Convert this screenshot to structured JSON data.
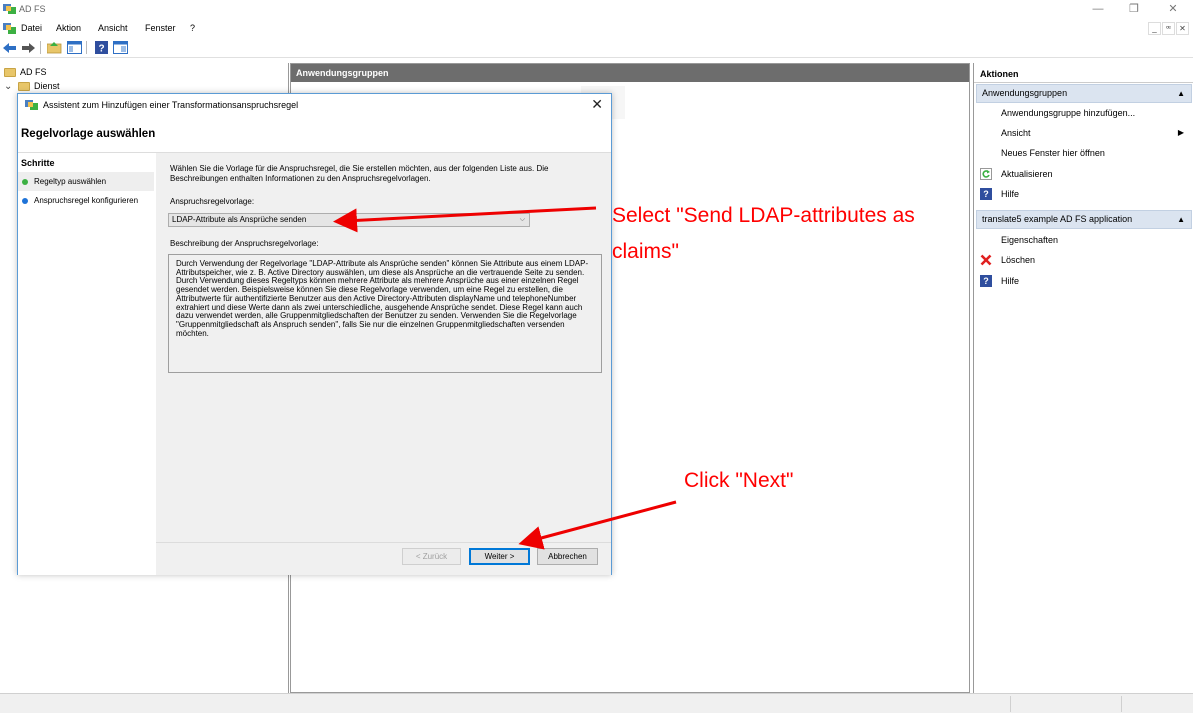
{
  "window": {
    "title": "AD FS",
    "minimize_glyph": "—",
    "restore_glyph": "❐",
    "close_glyph": "✕"
  },
  "menu": {
    "items": [
      "Datei",
      "Aktion",
      "Ansicht",
      "Fenster",
      "?"
    ],
    "mdi_buttons": [
      "_",
      "ꟹ",
      "✕"
    ]
  },
  "tree": {
    "root": "AD FS",
    "child": "Dienst",
    "expand_glyph": "⌄"
  },
  "center": {
    "header": "Anwendungsgruppen"
  },
  "actions": {
    "title": "Aktionen",
    "section1": {
      "label": "Anwendungsgruppen",
      "items": [
        {
          "label": "Anwendungsgruppe hinzufügen...",
          "icon": "none"
        },
        {
          "label": "Ansicht",
          "icon": "none",
          "submenu": "▶"
        },
        {
          "label": "Neues Fenster hier öffnen",
          "icon": "none"
        },
        {
          "label": "Aktualisieren",
          "icon": "refresh-icon"
        },
        {
          "label": "Hilfe",
          "icon": "help-icon"
        }
      ]
    },
    "section2": {
      "label": "translate5 example AD FS application",
      "items": [
        {
          "label": "Eigenschaften",
          "icon": "none"
        },
        {
          "label": "Löschen",
          "icon": "delete-icon"
        },
        {
          "label": "Hilfe",
          "icon": "help-icon"
        }
      ]
    },
    "collapse_glyph": "▲"
  },
  "dialog": {
    "title": "Assistent zum Hinzufügen einer Transformationsanspruchsregel",
    "close_glyph": "✕",
    "heading": "Regelvorlage auswählen",
    "steps_title": "Schritte",
    "steps": [
      {
        "label": "Regeltyp auswählen",
        "color": "#3cb043"
      },
      {
        "label": "Anspruchsregel konfigurieren",
        "color": "#1e73d8"
      }
    ],
    "intro": "Wählen Sie die Vorlage für die Anspruchsregel, die Sie erstellen möchten, aus der folgenden Liste aus. Die Beschreibungen enthalten Informationen zu den Anspruchsregelvorlagen.",
    "template_label": "Anspruchsregelvorlage:",
    "template_value": "LDAP-Attribute als Ansprüche senden",
    "combo_chevron": "⌵",
    "description_label": "Beschreibung der Anspruchsregelvorlage:",
    "description": "Durch Verwendung der Regelvorlage \"LDAP-Attribute als Ansprüche senden\" können Sie Attribute aus einem LDAP-Attributspeicher, wie z. B. Active Directory auswählen, um diese als Ansprüche an die vertrauende Seite zu senden. Durch Verwendung dieses Regeltyps können mehrere Attribute als mehrere Ansprüche aus einer einzelnen Regel gesendet werden. Beispielsweise können Sie diese Regelvorlage verwenden, um eine Regel zu erstellen, die Attributwerte für authentifizierte Benutzer aus den Active Directory-Attributen displayName und telephoneNumber extrahiert und diese Werte dann als zwei unterschiedliche, ausgehende Ansprüche sendet. Diese Regel kann auch dazu verwendet werden, alle Gruppenmitgliedschaften der Benutzer zu senden. Verwenden Sie die Regelvorlage \"Gruppenmitgliedschaft als Anspruch senden\", falls Sie nur die einzelnen Gruppenmitgliedschaften versenden möchten.",
    "buttons": {
      "back": "< Zurück",
      "next": "Weiter >",
      "cancel": "Abbrechen"
    }
  },
  "annotations": {
    "select_line1": "Select \"Send LDAP-attributes as",
    "select_line2": "claims\"",
    "click_next": "Click \"Next\"",
    "color": "#ff0000"
  }
}
